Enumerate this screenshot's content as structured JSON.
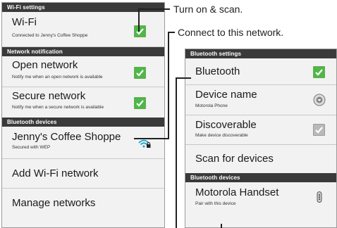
{
  "callouts": {
    "turn_on": "Turn on & scan.",
    "connect": "Connect to this network."
  },
  "wifi_panel": {
    "header": "Wi-Fi settings",
    "wifi": {
      "title": "Wi-Fi",
      "sub": "Connected to Jenny's Coffee Shoppe",
      "checked": true
    },
    "network_notification_header": "Network notification",
    "open_network": {
      "title": "Open network",
      "sub": "Notify me when an open network is available",
      "checked": true
    },
    "secure_network": {
      "title": "Secure network",
      "sub": "Notify me when a secure network is available",
      "checked": true
    },
    "bt_devices_header": "Bluetooth devices",
    "network": {
      "title": "Jenny's Coffee Shoppe",
      "sub": "Secured with WEP",
      "icon": "wifi-locked-icon"
    },
    "add_network": "Add Wi-Fi network",
    "manage_networks": "Manage networks"
  },
  "bt_panel": {
    "header": "Bluetooth settings",
    "bluetooth": {
      "title": "Bluetooth",
      "checked": true
    },
    "device_name": {
      "title": "Device name",
      "sub": "Motorola Phone",
      "icon": "radio-selected-icon"
    },
    "discoverable": {
      "title": "Discoverable",
      "sub": "Make device discoverable",
      "checked": true,
      "disabled": true
    },
    "scan": "Scan for devices",
    "devices_header": "Bluetooth devices",
    "handset": {
      "title": "Motorola Handset",
      "sub": "Pair with this device",
      "icon": "bluetooth-headset-icon"
    }
  },
  "colors": {
    "section_bg": "#3a3a3a",
    "check_green": "#4db848",
    "check_disabled": "#b9b9b9",
    "panel_bg": "#f2f2f2"
  }
}
